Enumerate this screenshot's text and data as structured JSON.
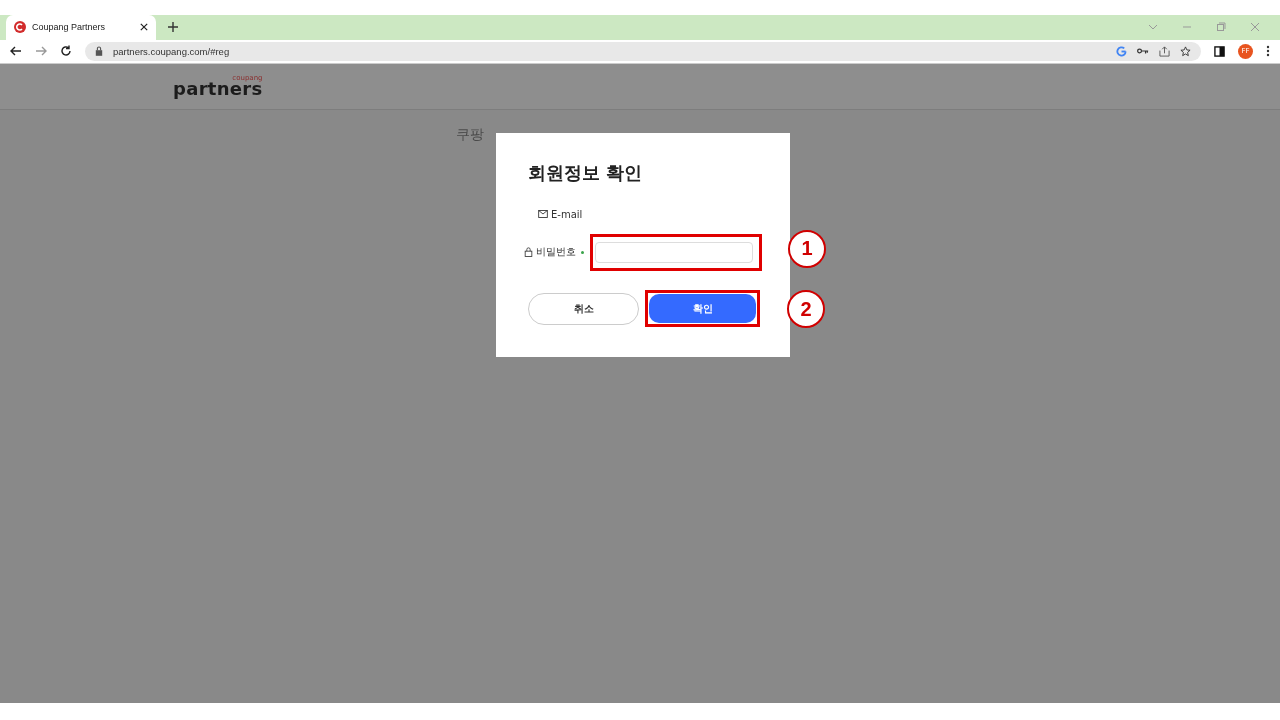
{
  "browser": {
    "tab": {
      "title": "Coupang Partners",
      "selected": true
    },
    "url": "partners.coupang.com/#reg",
    "profile": "FF"
  },
  "header": {
    "logo_small": "coupang",
    "logo": "partners"
  },
  "page": {
    "title": "쿠팡"
  },
  "dialog": {
    "title": "회원정보 확인",
    "email_label": "E-mail",
    "password_label": "비밀번호",
    "required": true,
    "cancel": "취소",
    "confirm": "확인",
    "password_step": "1",
    "confirm_step": "2"
  }
}
